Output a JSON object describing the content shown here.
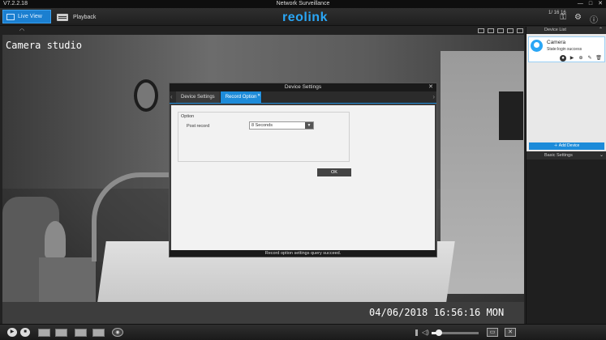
{
  "titlebar": {
    "version": "V7.2.2.18",
    "title": "Network Surveillance",
    "min": "—",
    "max": "□",
    "close": "✕"
  },
  "toolbar": {
    "live_label": "Live View",
    "playback_label": "Playback",
    "logo": "reolink",
    "date": "1/ 16 16",
    "icons": [
      "lock-icon",
      "gear-icon",
      "info-icon"
    ]
  },
  "video": {
    "osd_name": "Camera studio",
    "osd_time": "04/06/2018 16:56:16 MON"
  },
  "dialog": {
    "title": "Device Settings",
    "close": "✕",
    "tabs": [
      {
        "label": "Device Settings",
        "active": false
      },
      {
        "label": "Record Option",
        "active": true
      }
    ],
    "group_label": "Option",
    "post_record_label": "Post record",
    "post_record_value": "8 Seconds",
    "ok_label": "OK",
    "status": "Record option settings query succeed."
  },
  "right_panel": {
    "device_list_label": "Device List",
    "camera_name": "Camera",
    "camera_status": "State:login success",
    "add_device_label": "Add Device",
    "basic_settings_label": "Basic Settings"
  },
  "colors": {
    "accent": "#1d8bd9",
    "logo": "#2aa6f5"
  },
  "volume_level": 0.15
}
